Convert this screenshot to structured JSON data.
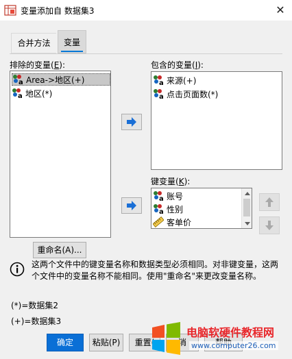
{
  "window": {
    "title": "变量添加自 数据集3",
    "close": "✕"
  },
  "tabs": [
    {
      "label": "合并方法",
      "active": false
    },
    {
      "label": "变量",
      "active": true
    }
  ],
  "excluded": {
    "label_prefix": "排除的变量(",
    "label_key": "E",
    "label_suffix": "):",
    "items": [
      {
        "label": "Area->地区(+)",
        "type": "nominal",
        "selected": true
      },
      {
        "label": "地区(*)",
        "type": "nominal",
        "selected": false
      }
    ]
  },
  "included": {
    "label_prefix": "包含的变量(",
    "label_key": "I",
    "label_suffix": "):",
    "items": [
      {
        "label": "来源(+)",
        "type": "nominal"
      },
      {
        "label": "点击页面数(*)",
        "type": "nominal"
      }
    ]
  },
  "key_vars": {
    "label_prefix": "键变量(",
    "label_key": "K",
    "label_suffix": "):",
    "items": [
      {
        "label": "账号",
        "type": "nominal"
      },
      {
        "label": "性别",
        "type": "nominal"
      },
      {
        "label": "客单价",
        "type": "scale"
      }
    ]
  },
  "buttons": {
    "rename": "重命名(A)...",
    "ok": "确定",
    "paste": "粘贴(P)",
    "reset": "重置(",
    "cancel": "消",
    "help": "帮助"
  },
  "info": {
    "text": "这两个文件中的键变量名称和数据类型必须相同。对非键变量，这两个文件中的变量名称不能相同。使用\"重命名\"来更改变量名称。"
  },
  "notes": {
    "star": "(*)=数据集2",
    "plus": "(+)=数据集3"
  },
  "watermark": {
    "title": "电脑软硬件教程网",
    "url": "www.computer26.com"
  },
  "colors": {
    "accent": "#0078d7",
    "ok_button": "#0a6fd6",
    "move_arrow": "#1a6fd6",
    "watermark_red": "#e8262a",
    "watermark_blue": "#1d5fb8"
  }
}
